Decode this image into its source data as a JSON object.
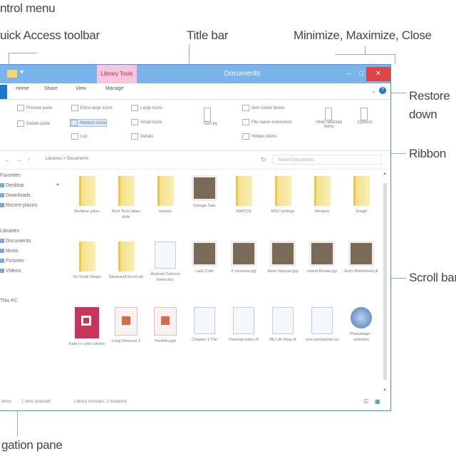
{
  "callouts": {
    "scroll_menu": "ntrol menu",
    "quick_access": "uick Access toolbar",
    "title_bar": "Title bar",
    "min_max_close": "Minimize, Maximize, Close",
    "restore_down": "Restore\ndown",
    "ribbon": "Ribbon",
    "scroll_bar": "Scroll bar",
    "navigation_pane": "gation pane"
  },
  "window": {
    "title": "Documents",
    "contextual_tab": "Library Tools",
    "controls": {
      "minimize": "–",
      "maximize": "□",
      "close": "✕"
    },
    "tabs": [
      "Home",
      "Share",
      "View",
      "Manage"
    ],
    "ribbon": {
      "panes": [
        "Preview pane",
        "Details pane"
      ],
      "layout": [
        "Extra large icons",
        "Large icons",
        "Medium icons",
        "Small icons",
        "List",
        "Details"
      ],
      "current_view": [
        "Sort by"
      ],
      "show_hide": [
        "Item check boxes",
        "File name extensions",
        "Hidden items"
      ],
      "buttons": [
        "Hide selected items",
        "Options"
      ]
    },
    "address": {
      "path": "Libraries  >  Documents",
      "search_placeholder": "Search Documents"
    },
    "nav_pane": [
      "Favorites",
      "Desktop",
      "Downloads",
      "Recent places",
      "",
      "Libraries",
      "Documents",
      "Music",
      "Pictures",
      "Videos",
      "",
      "This PC"
    ],
    "files": [
      {
        "name": "Bedtime jokes",
        "type": "folder"
      },
      {
        "name": "Best Tech Ideas Kids",
        "type": "folder"
      },
      {
        "name": "ebooks",
        "type": "folder"
      },
      {
        "name": "Garage Sale",
        "type": "photo"
      },
      {
        "name": "IWATCH",
        "type": "folder"
      },
      {
        "name": "MSC writings",
        "type": "folder"
      },
      {
        "name": "Recipes",
        "type": "folder"
      },
      {
        "name": "Snagit",
        "type": "folder"
      },
      {
        "name": "So Small Single",
        "type": "folder"
      },
      {
        "name": "Stonewall Excel.zip",
        "type": "folder"
      },
      {
        "name": "Android Camera home.doc",
        "type": "doc"
      },
      {
        "name": "Lady Cafe",
        "type": "photo"
      },
      {
        "name": "2 cameras.jpg",
        "type": "photo"
      },
      {
        "name": "Bean Sprouts.jpg",
        "type": "photo"
      },
      {
        "name": "Island Roads.jpg",
        "type": "photo"
      },
      {
        "name": "Early Retirement.jk",
        "type": "photo"
      },
      {
        "name": "Kathy's card column",
        "type": "pub"
      },
      {
        "name": "Long Distance 1",
        "type": "ppt"
      },
      {
        "name": "Portfolio.ppt",
        "type": "ppt"
      },
      {
        "name": "Chapter 1 The",
        "type": "doc"
      },
      {
        "name": "Passing notes.rtf",
        "type": "doc"
      },
      {
        "name": "My Life Blog.rtf",
        "type": "doc"
      },
      {
        "name": "new passwords.txt",
        "type": "txt"
      },
      {
        "name": "Photostage - websites",
        "type": "globe"
      }
    ],
    "status": {
      "count": "items",
      "selected": "1 item selected",
      "library": "Library includes: 2 locations"
    }
  }
}
